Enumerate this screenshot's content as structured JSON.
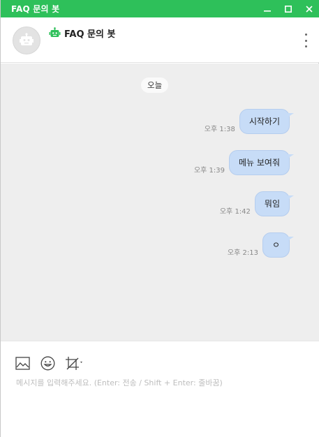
{
  "window": {
    "title": "FAQ 문의 봇",
    "accent_color": "#2ec05a",
    "controls": [
      "minimize-icon",
      "maximize-icon",
      "close-icon"
    ]
  },
  "header": {
    "bot_icon": "robot-icon",
    "chat_name": "FAQ 문의 봇",
    "menu_icon": "more-vertical-icon"
  },
  "chat": {
    "date_divider": "오늘",
    "messages": [
      {
        "text": "시작하기",
        "time": "오후 1:38"
      },
      {
        "text": "메뉴 보여줘",
        "time": "오후 1:39"
      },
      {
        "text": "뭐임",
        "time": "오후 1:42"
      },
      {
        "text": "ㅇ",
        "time": "오후 2:13"
      }
    ]
  },
  "composer": {
    "tools": [
      "image-icon",
      "emoji-icon",
      "crop-icon"
    ],
    "placeholder": "메시지를 입력해주세요. (Enter: 전송 / Shift + Enter: 줄바꿈)"
  }
}
